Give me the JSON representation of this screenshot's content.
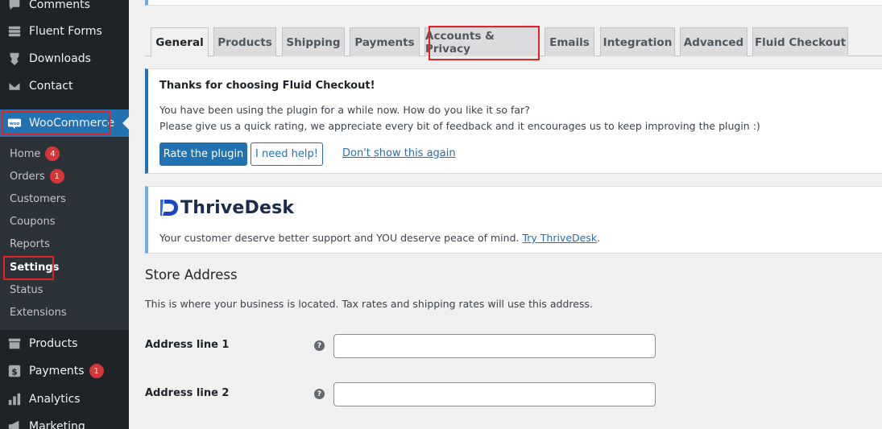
{
  "sidebar": {
    "menu": [
      {
        "label": "Comments",
        "icon": "comment-icon"
      },
      {
        "label": "Fluent Forms",
        "icon": "database-icon"
      },
      {
        "label": "Downloads",
        "icon": "download-icon"
      },
      {
        "label": "Contact",
        "icon": "envelope-icon"
      },
      {
        "label": "WooCommerce",
        "icon": "woo-icon"
      },
      {
        "label": "Products",
        "icon": "archive-icon"
      },
      {
        "label": "Payments",
        "icon": "dollar-icon",
        "badge": "1"
      },
      {
        "label": "Analytics",
        "icon": "bar-chart-icon"
      },
      {
        "label": "Marketing",
        "icon": "megaphone-icon"
      }
    ],
    "woo_submenu": [
      {
        "label": "Home",
        "badge": "4"
      },
      {
        "label": "Orders",
        "badge": "1"
      },
      {
        "label": "Customers"
      },
      {
        "label": "Coupons"
      },
      {
        "label": "Reports"
      },
      {
        "label": "Settings"
      },
      {
        "label": "Status"
      },
      {
        "label": "Extensions"
      }
    ],
    "accent_color": "#2271b1"
  },
  "tabs": [
    "General",
    "Products",
    "Shipping",
    "Payments",
    "Accounts & Privacy",
    "Emails",
    "Integration",
    "Advanced",
    "Fluid Checkout"
  ],
  "active_tab": "General",
  "notice": {
    "title": "Thanks for choosing Fluid Checkout!",
    "line1": "You have been using the plugin for a while now. How do you like it so far?",
    "line2": "Please give us a quick rating, we appreciate every bit of feedback and it encourages us to keep improving the plugin :)",
    "rate_button": "Rate the plugin",
    "help_button": "I need help!",
    "dismiss_link": "Don't show this again"
  },
  "thrivedesk": {
    "brand": "ThriveDesk",
    "text": "Your customer deserve better support and YOU deserve peace of mind.",
    "link": "Try ThriveDesk",
    "suffix": "."
  },
  "store": {
    "title": "Store Address",
    "description": "This is where your business is located. Tax rates and shipping rates will use this address.",
    "address1_label": "Address line 1",
    "address1_value": "",
    "address2_label": "Address line 2",
    "address2_value": "",
    "help_glyph": "?"
  }
}
